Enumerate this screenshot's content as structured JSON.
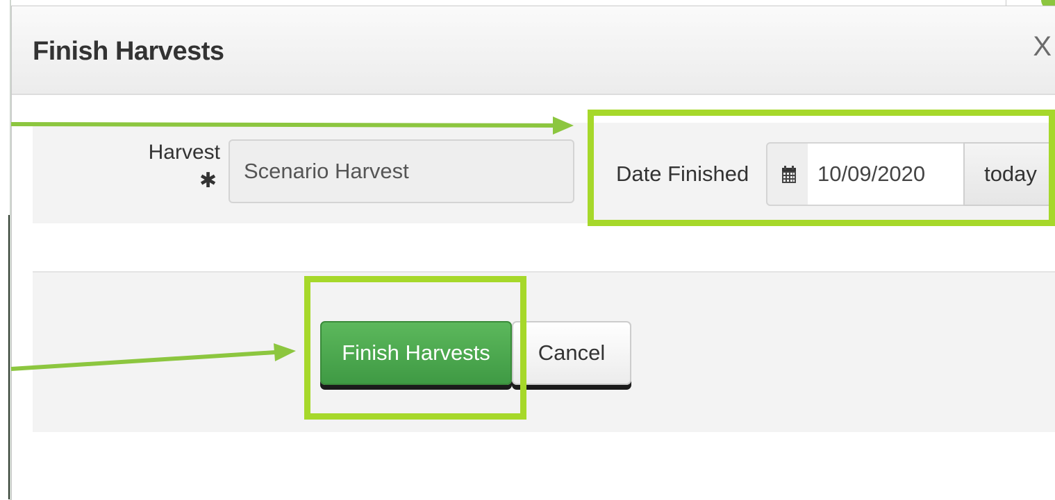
{
  "dialog": {
    "title": "Finish Harvests",
    "close_label": "X"
  },
  "form": {
    "harvest": {
      "label": "Harvest",
      "required_marker": "✱",
      "value": "Scenario Harvest"
    },
    "date_finished": {
      "label": "Date Finished",
      "icon": "calendar-icon",
      "value": "10/09/2020",
      "today_label": "today"
    }
  },
  "footer": {
    "finish_label": "Finish Harvests",
    "cancel_label": "Cancel"
  },
  "colors": {
    "annotation_accent": "#a6d82a",
    "annotation_arrow": "#8cc63f",
    "primary_button": "#4cae4c"
  }
}
